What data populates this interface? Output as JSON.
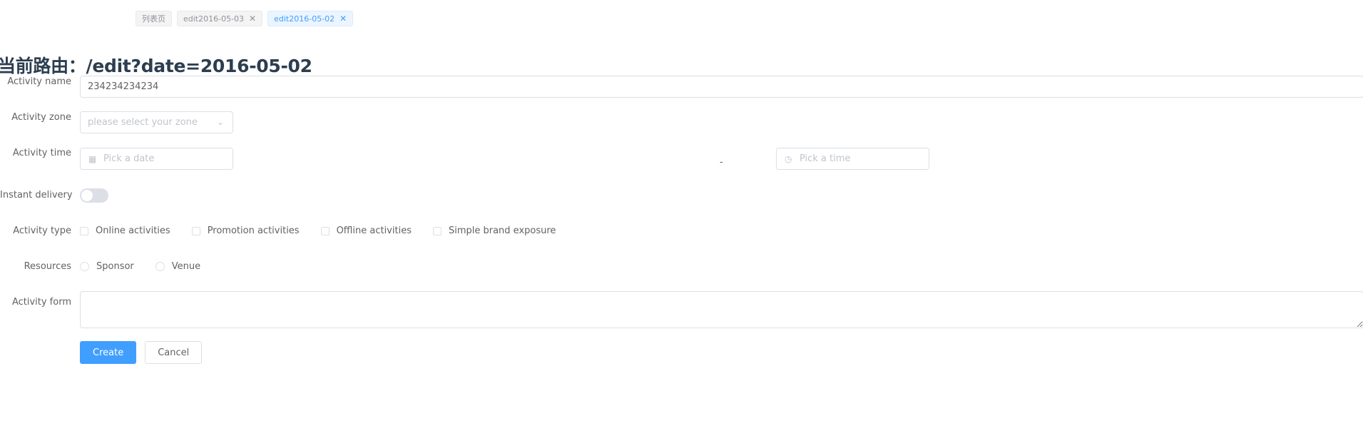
{
  "tags": [
    {
      "label": "列表页",
      "closable": false,
      "active": false
    },
    {
      "label": "edit2016-05-03",
      "closable": true,
      "active": false
    },
    {
      "label": "edit2016-05-02",
      "closable": true,
      "active": true
    }
  ],
  "route": {
    "title": "当前路由：/edit?date=2016-05-02"
  },
  "form": {
    "name": {
      "label": "Activity name",
      "value": "234234234234"
    },
    "zone": {
      "label": "Activity zone",
      "placeholder": "please select your zone"
    },
    "time": {
      "label": "Activity time",
      "date_placeholder": "Pick a date",
      "separator": "-",
      "time_placeholder": "Pick a time"
    },
    "delivery": {
      "label": "Instant delivery",
      "on": false
    },
    "type": {
      "label": "Activity type",
      "options": [
        "Online activities",
        "Promotion activities",
        "Offline activities",
        "Simple brand exposure"
      ]
    },
    "resources": {
      "label": "Resources",
      "options": [
        "Sponsor",
        "Venue"
      ]
    },
    "form_desc": {
      "label": "Activity form",
      "value": ""
    },
    "buttons": {
      "create": "Create",
      "cancel": "Cancel"
    }
  },
  "colors": {
    "primary": "#409eff",
    "title": "#2c3e50",
    "border": "#dcdfe6",
    "placeholder": "#c0c4cc"
  }
}
